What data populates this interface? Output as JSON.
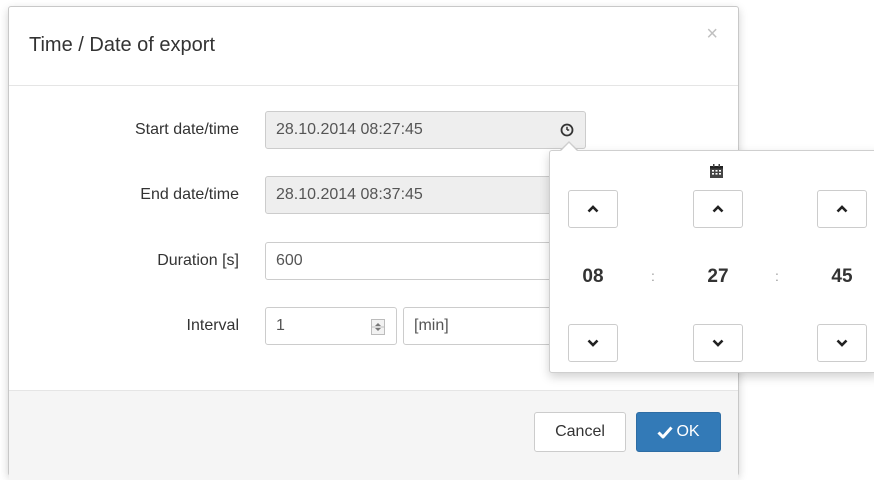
{
  "dialog": {
    "title": "Time / Date of export",
    "close_symbol": "×"
  },
  "form": {
    "start": {
      "label": "Start date/time",
      "value": "28.10.2014 08:27:45"
    },
    "end": {
      "label": "End date/time",
      "value": "28.10.2014 08:37:45"
    },
    "duration": {
      "label": "Duration [s]",
      "value": "600"
    },
    "interval": {
      "label": "Interval",
      "value": "1",
      "unit": "[min]"
    }
  },
  "time_picker": {
    "hours": "08",
    "minutes": "27",
    "seconds": "45",
    "separator": ":"
  },
  "footer": {
    "cancel_label": "Cancel",
    "ok_label": "OK"
  },
  "icons": {
    "clock": "clock-icon",
    "calendar": "calendar-icon",
    "check": "check-icon",
    "chevron_up": "chevron-up-icon",
    "chevron_down": "chevron-down-icon",
    "spinner": "spinner-arrows-icon"
  },
  "colors": {
    "primary": "#337ab7",
    "readonly_bg": "#eeeeee",
    "border": "#cccccc",
    "text": "#333333"
  }
}
